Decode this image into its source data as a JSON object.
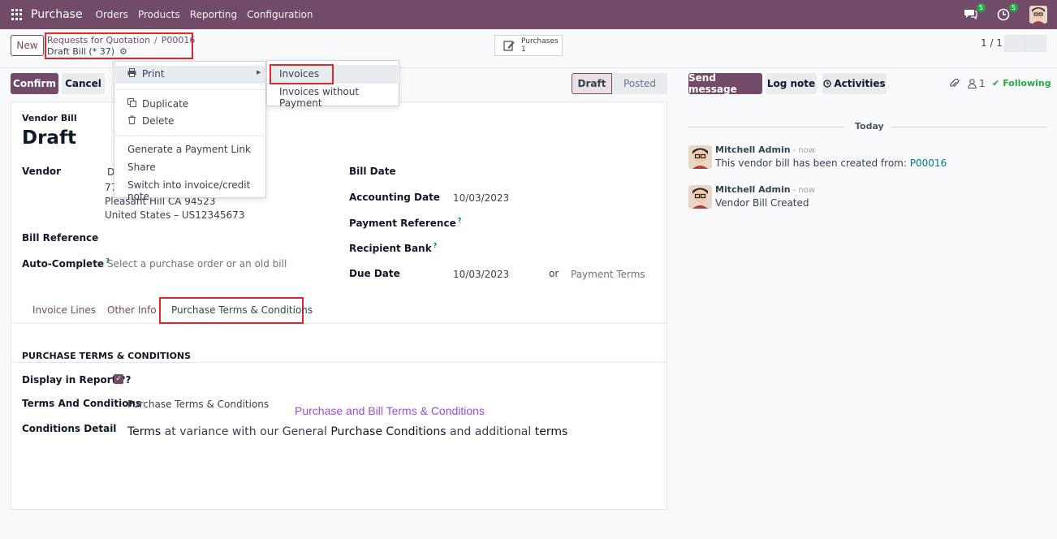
{
  "navbar": {
    "brand": "Purchase",
    "menu": [
      "Orders",
      "Products",
      "Reporting",
      "Configuration"
    ],
    "messages_count": "5",
    "activities_count": "5"
  },
  "control": {
    "new_label": "New",
    "breadcrumb_parent": "Requests for Quotation",
    "breadcrumb_sep": "/",
    "breadcrumb_current": "P00016",
    "record_name": "Draft Bill (* 37)",
    "smart_button_label": "Purchases",
    "smart_button_count": "1",
    "pager": "1 / 1"
  },
  "actions": {
    "confirm": "Confirm",
    "cancel": "Cancel"
  },
  "statusbar": [
    "Draft",
    "Posted"
  ],
  "form": {
    "doc_type": "Vendor Bill",
    "title": "Draft",
    "vendor_label": "Vendor",
    "vendor_lines": [
      "D",
      "77",
      "Pleasant Hill CA 94523",
      "United States – US12345673"
    ],
    "bill_reference_label": "Bill Reference",
    "auto_complete_label": "Auto-Complete",
    "auto_complete_placeholder": "Select a purchase order or an old bill",
    "bill_date_label": "Bill Date",
    "accounting_date_label": "Accounting Date",
    "accounting_date": "10/03/2023",
    "payment_reference_label": "Payment Reference",
    "recipient_bank_label": "Recipient Bank",
    "due_date_label": "Due Date",
    "due_date": "10/03/2023",
    "or": "or",
    "payment_terms_placeholder": "Payment Terms",
    "help_mark": "?"
  },
  "tabs": [
    "Invoice Lines",
    "Other Info",
    "Purchase Terms & Conditions"
  ],
  "terms": {
    "section_title": "PURCHASE TERMS & CONDITIONS",
    "display_label": "Display in Report ??",
    "terms_label": "Terms And Conditions",
    "terms_value": "Purchase Terms & Conditions",
    "terms_heading": "Purchase and Bill Terms & Conditions",
    "detail_label": "Conditions Detail",
    "detail_parts": [
      "Terms",
      " at variance with our General ",
      "Purchase Conditions",
      " and additional ",
      "terms"
    ]
  },
  "dropdown": {
    "print": "Print",
    "duplicate": "Duplicate",
    "delete": "Delete",
    "payment_link": "Generate a Payment Link",
    "share": "Share",
    "switch": "Switch into invoice/credit note"
  },
  "print_submenu": [
    "Invoices",
    "Invoices without Payment"
  ],
  "chatter": {
    "send_message": "Send message",
    "log_note": "Log note",
    "activities": "Activities",
    "followers_count": "1",
    "following": "Following",
    "today": "Today",
    "messages": [
      {
        "author": "Mitchell Admin",
        "time": "- now",
        "body": "This vendor bill has been created from: ",
        "link": "P00016"
      },
      {
        "author": "Mitchell Admin",
        "time": "- now",
        "body": "Vendor Bill Created",
        "link": ""
      }
    ]
  },
  "colors": {
    "brand": "#714b67",
    "highlight_border": "#e3262c",
    "link": "#017e84",
    "terms_heading": "#9b4ed8"
  }
}
